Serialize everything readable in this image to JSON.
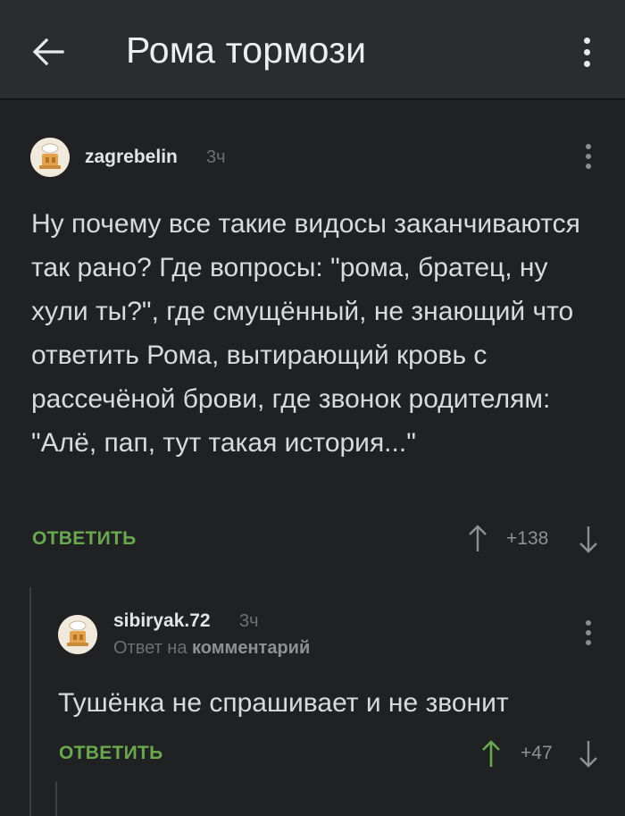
{
  "header": {
    "title": "Рома тормози"
  },
  "comment1": {
    "username": "zagrebelin",
    "time": "3ч",
    "text": "Ну почему все такие видосы заканчиваются так рано? Где вопросы: \"рома, братец, ну хули ты?\", где смущённый, не знающий что ответить Рома, вытирающий кровь с рассечёной брови,  где звонок родителям: \"Алё, пап, тут такая история...\"",
    "reply_label": "ОТВЕТИТЬ",
    "rating": "+138"
  },
  "comment2": {
    "username": "sibiryak.72",
    "time": "3ч",
    "answer_prefix": "Ответ на",
    "answer_target": "комментарий",
    "text": "Тушёнка не спрашивает и не звонит",
    "reply_label": "ОТВЕТИТЬ",
    "rating": "+47",
    "upvote_color": "#6aa84f"
  },
  "colors": {
    "background": "#1f2123",
    "appbar": "#2a2c2e",
    "accent": "#6aa84f"
  },
  "icons": [
    "back-arrow-icon",
    "more-vert-icon",
    "avatar-icon",
    "upvote-arrow-icon",
    "downvote-arrow-icon"
  ]
}
